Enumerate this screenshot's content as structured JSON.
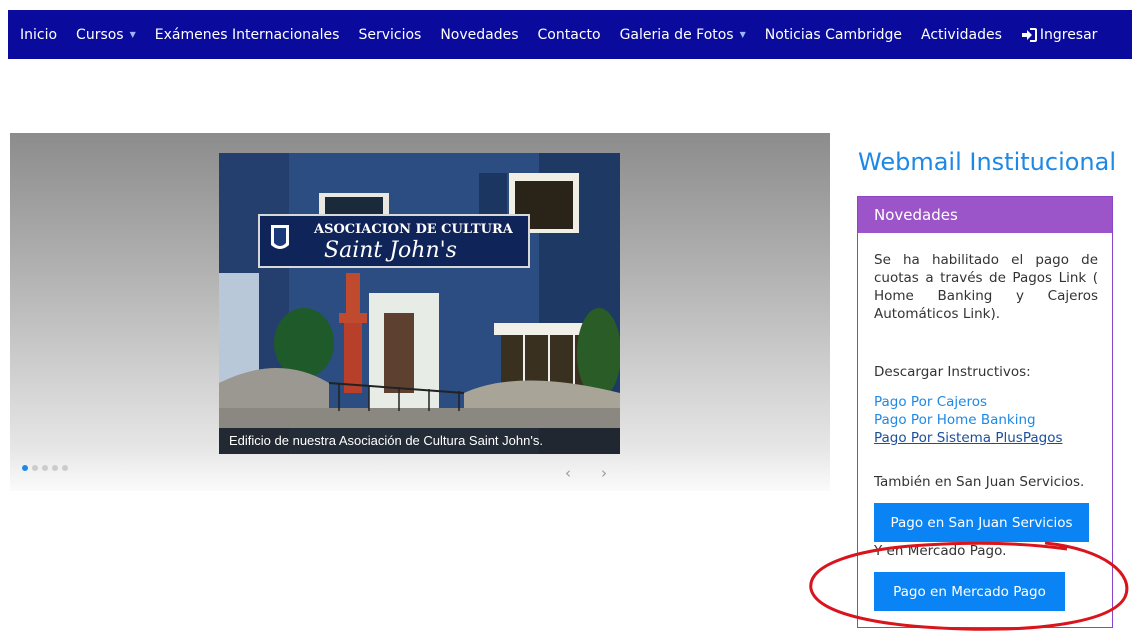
{
  "nav": {
    "items": [
      {
        "label": "Inicio",
        "dropdown": false
      },
      {
        "label": "Cursos",
        "dropdown": true
      },
      {
        "label": "Exámenes Internacionales",
        "dropdown": false
      },
      {
        "label": "Servicios",
        "dropdown": false
      },
      {
        "label": "Novedades",
        "dropdown": false
      },
      {
        "label": "Contacto",
        "dropdown": false
      },
      {
        "label": "Galeria de Fotos",
        "dropdown": true
      },
      {
        "label": "Noticias Cambridge",
        "dropdown": false
      },
      {
        "label": "Actividades",
        "dropdown": false
      }
    ],
    "signin_label": "Ingresar",
    "signin_icon": "sign-in-icon",
    "background": "#0a0a9c"
  },
  "carousel": {
    "sign_line1": "ASOCIACION DE CULTURA",
    "sign_line2": "Saint John's",
    "caption": "Edificio de nuestra Asociación de Cultura Saint John's.",
    "slide_count": 5,
    "active_slide": 1,
    "prev_symbol": "‹",
    "next_symbol": "›"
  },
  "sidebar": {
    "webmail_label": "Webmail Institucional",
    "panel_title": "Novedades",
    "panel_color": "#9b55c9",
    "intro_text": "Se ha habilitado el pago de cuotas a través de  Pagos Link ( Home Banking y Cajeros Automáticos Link).",
    "download_label": "Descargar Instructivos:",
    "links": [
      "Pago Por Cajeros",
      "Pago Por Home Banking",
      "Pago Por Sistema PlusPagos"
    ],
    "san_juan_text": "También en San Juan Servicios.",
    "san_juan_button": "Pago en San Juan Servicios",
    "mercado_text": "Y en Mercado Pago.",
    "mercado_button": "Pago en Mercado Pago",
    "button_color": "#0a84f5"
  },
  "annotation": {
    "color": "#d8141c"
  }
}
